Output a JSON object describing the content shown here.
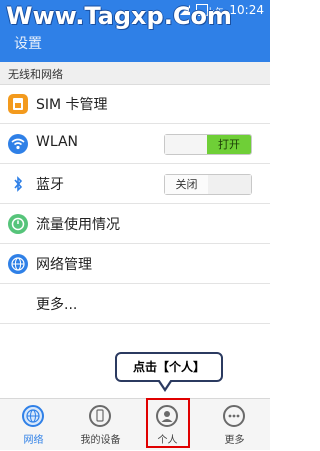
{
  "watermark": "Www.Tagxp.Com",
  "status": {
    "ampm": "上午",
    "time": "10:24"
  },
  "title": "设置",
  "section": "无线和网络",
  "rows": [
    {
      "label": "SIM 卡管理",
      "icon": "sim-icon",
      "color": "#f39a1d"
    },
    {
      "label": "WLAN",
      "icon": "wifi-icon",
      "color": "#2f80e7",
      "toggle": "打开"
    },
    {
      "label": "蓝牙",
      "icon": "bluetooth-icon",
      "color": "#2f80e7",
      "toggle": "关闭"
    },
    {
      "label": "流量使用情况",
      "icon": "data-usage-icon",
      "color": "#56c47a"
    },
    {
      "label": "网络管理",
      "icon": "globe-icon",
      "color": "#2f80e7"
    },
    {
      "label": "更多..."
    }
  ],
  "tooltip": "点击【个人】",
  "nav": [
    {
      "label": "网络",
      "icon": "globe-icon",
      "active": true
    },
    {
      "label": "我的设备",
      "icon": "phone-icon"
    },
    {
      "label": "个人",
      "icon": "person-icon"
    },
    {
      "label": "更多",
      "icon": "more-icon"
    }
  ],
  "colors": {
    "accent": "#2f80e7",
    "toggle_on": "#6fcf37",
    "highlight": "#e00000"
  }
}
